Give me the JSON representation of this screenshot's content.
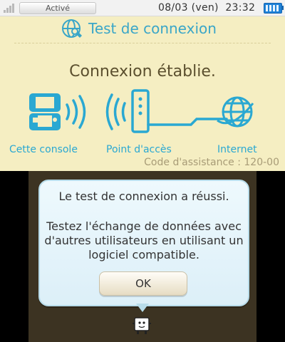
{
  "status_bar": {
    "wifi_label": "Activé",
    "date": "08/03 (ven)",
    "time": "23:32",
    "battery_color": "#1f82d8"
  },
  "top_screen": {
    "title": "Test de connexion",
    "title_icon": "network-settings-icon",
    "headline": "Connexion établie.",
    "devices": [
      {
        "label": "Cette console",
        "icon": "console-icon"
      },
      {
        "label": "Point d'accès",
        "icon": "access-point-icon"
      },
      {
        "label": "Internet",
        "icon": "globe-icon"
      }
    ],
    "help_code": "Code d'assistance : 120-00",
    "accent_color": "#2aa8d2",
    "background_color": "#f5eec2"
  },
  "dialog": {
    "message_line1": "Le test de connexion a réussi.",
    "message_line2": "Testez l'échange de données avec d'autres utilisateurs en utilisant un logiciel compatible.",
    "ok_label": "OK",
    "mascot_icon": "mascot-icon"
  }
}
